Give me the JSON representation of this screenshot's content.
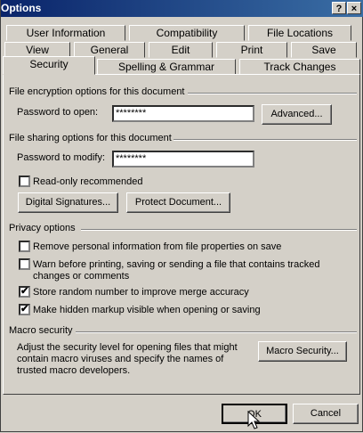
{
  "window": {
    "title": "Options",
    "help_glyph": "?",
    "close_glyph": "×"
  },
  "tabs": {
    "row1": [
      "User Information",
      "Compatibility",
      "File Locations"
    ],
    "row2": [
      "View",
      "General",
      "Edit",
      "Print",
      "Save"
    ],
    "row3": [
      "Security",
      "Spelling & Grammar",
      "Track Changes"
    ],
    "active": "Security"
  },
  "encryption": {
    "title": "File encryption options for this document",
    "password_label": "Password to open:",
    "password_value": "********",
    "advanced_label": "Advanced..."
  },
  "sharing": {
    "title": "File sharing options for this document",
    "password_label": "Password to modify:",
    "password_value": "********",
    "readonly_label": "Read-only recommended",
    "readonly_checked": false,
    "digital_sig_label": "Digital Signatures...",
    "protect_label": "Protect Document..."
  },
  "privacy": {
    "title": "Privacy options",
    "items": [
      {
        "label": "Remove personal information from file properties on save",
        "checked": false
      },
      {
        "label": "Warn before printing, saving or sending a file that contains tracked",
        "label2": "changes or comments",
        "checked": false
      },
      {
        "label": "Store random number to improve merge accuracy",
        "checked": true
      },
      {
        "label": "Make hidden markup visible when opening or saving",
        "checked": true
      }
    ]
  },
  "macro": {
    "title": "Macro security",
    "description_lines": [
      "Adjust the security level for opening files that might",
      "contain macro viruses and specify the names of",
      "trusted macro developers."
    ],
    "button_label": "Macro Security..."
  },
  "footer": {
    "ok_label": "OK",
    "cancel_label": "Cancel"
  },
  "check_glyph": "✔"
}
